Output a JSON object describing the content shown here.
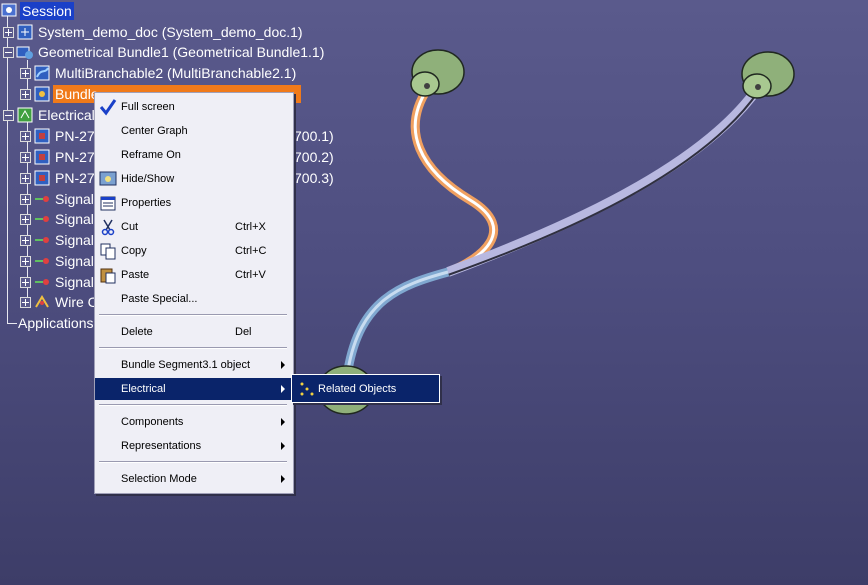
{
  "tree": {
    "session": "Session",
    "items": [
      "System_demo_doc (System_demo_doc.1)",
      "Geometrical Bundle1 (Geometrical Bundle1.1)",
      "MultiBranchable2 (MultiBranchable2.1)",
      "Bundle",
      "Electrical",
      "PN-27",
      "PN-27",
      "PN-27",
      "Signal",
      "Signal",
      "Signal",
      "Signal",
      "Signal",
      "Wire C",
      "Applications"
    ],
    "hidden_suffixes": [
      "700.1)",
      "700.2)",
      "700.3)"
    ]
  },
  "context_menu": {
    "items": [
      {
        "label": "Full screen",
        "shortcut": "",
        "submenu": false,
        "checked": true
      },
      {
        "label": "Center Graph",
        "shortcut": "",
        "submenu": false
      },
      {
        "label": "Reframe On",
        "shortcut": "",
        "submenu": false
      },
      {
        "label": "Hide/Show",
        "shortcut": "",
        "submenu": false
      },
      {
        "label": "Properties",
        "shortcut": "",
        "submenu": false
      },
      {
        "label": "Cut",
        "shortcut": "Ctrl+X",
        "submenu": false
      },
      {
        "label": "Copy",
        "shortcut": "Ctrl+C",
        "submenu": false
      },
      {
        "label": "Paste",
        "shortcut": "Ctrl+V",
        "submenu": false
      },
      {
        "label": "Paste Special...",
        "shortcut": "",
        "submenu": false
      },
      {
        "label": "Delete",
        "shortcut": "Del",
        "submenu": false
      },
      {
        "label": "Bundle Segment3.1 object",
        "shortcut": "",
        "submenu": true
      },
      {
        "label": "Electrical",
        "shortcut": "",
        "submenu": true,
        "highlighted": true
      },
      {
        "label": "Components",
        "shortcut": "",
        "submenu": true
      },
      {
        "label": "Representations",
        "shortcut": "",
        "submenu": true
      },
      {
        "label": "Selection Mode",
        "shortcut": "",
        "submenu": true
      }
    ]
  },
  "submenu": {
    "label": "Related Objects"
  },
  "colors": {
    "background": "#5a5a8c",
    "selection_orange": "#f07a1a",
    "session_blue": "#1a40c8",
    "menu_highlight": "#0a246a",
    "connector_green": "#8fb07a"
  }
}
